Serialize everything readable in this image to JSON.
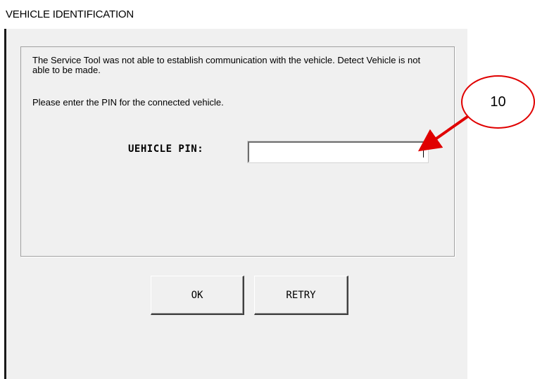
{
  "window": {
    "title": "VEHICLE IDENTIFICATION"
  },
  "dialog": {
    "message": "The Service Tool was not able to establish communication with the vehicle. Detect Vehicle is not able to be made.",
    "prompt": "Please enter the PIN for the connected vehicle.",
    "pin_label": "UEHICLE PIN:",
    "pin_value": "",
    "ok_label": "OK",
    "retry_label": "RETRY"
  },
  "annotation": {
    "callout_number": "10",
    "color": "#e00000"
  }
}
